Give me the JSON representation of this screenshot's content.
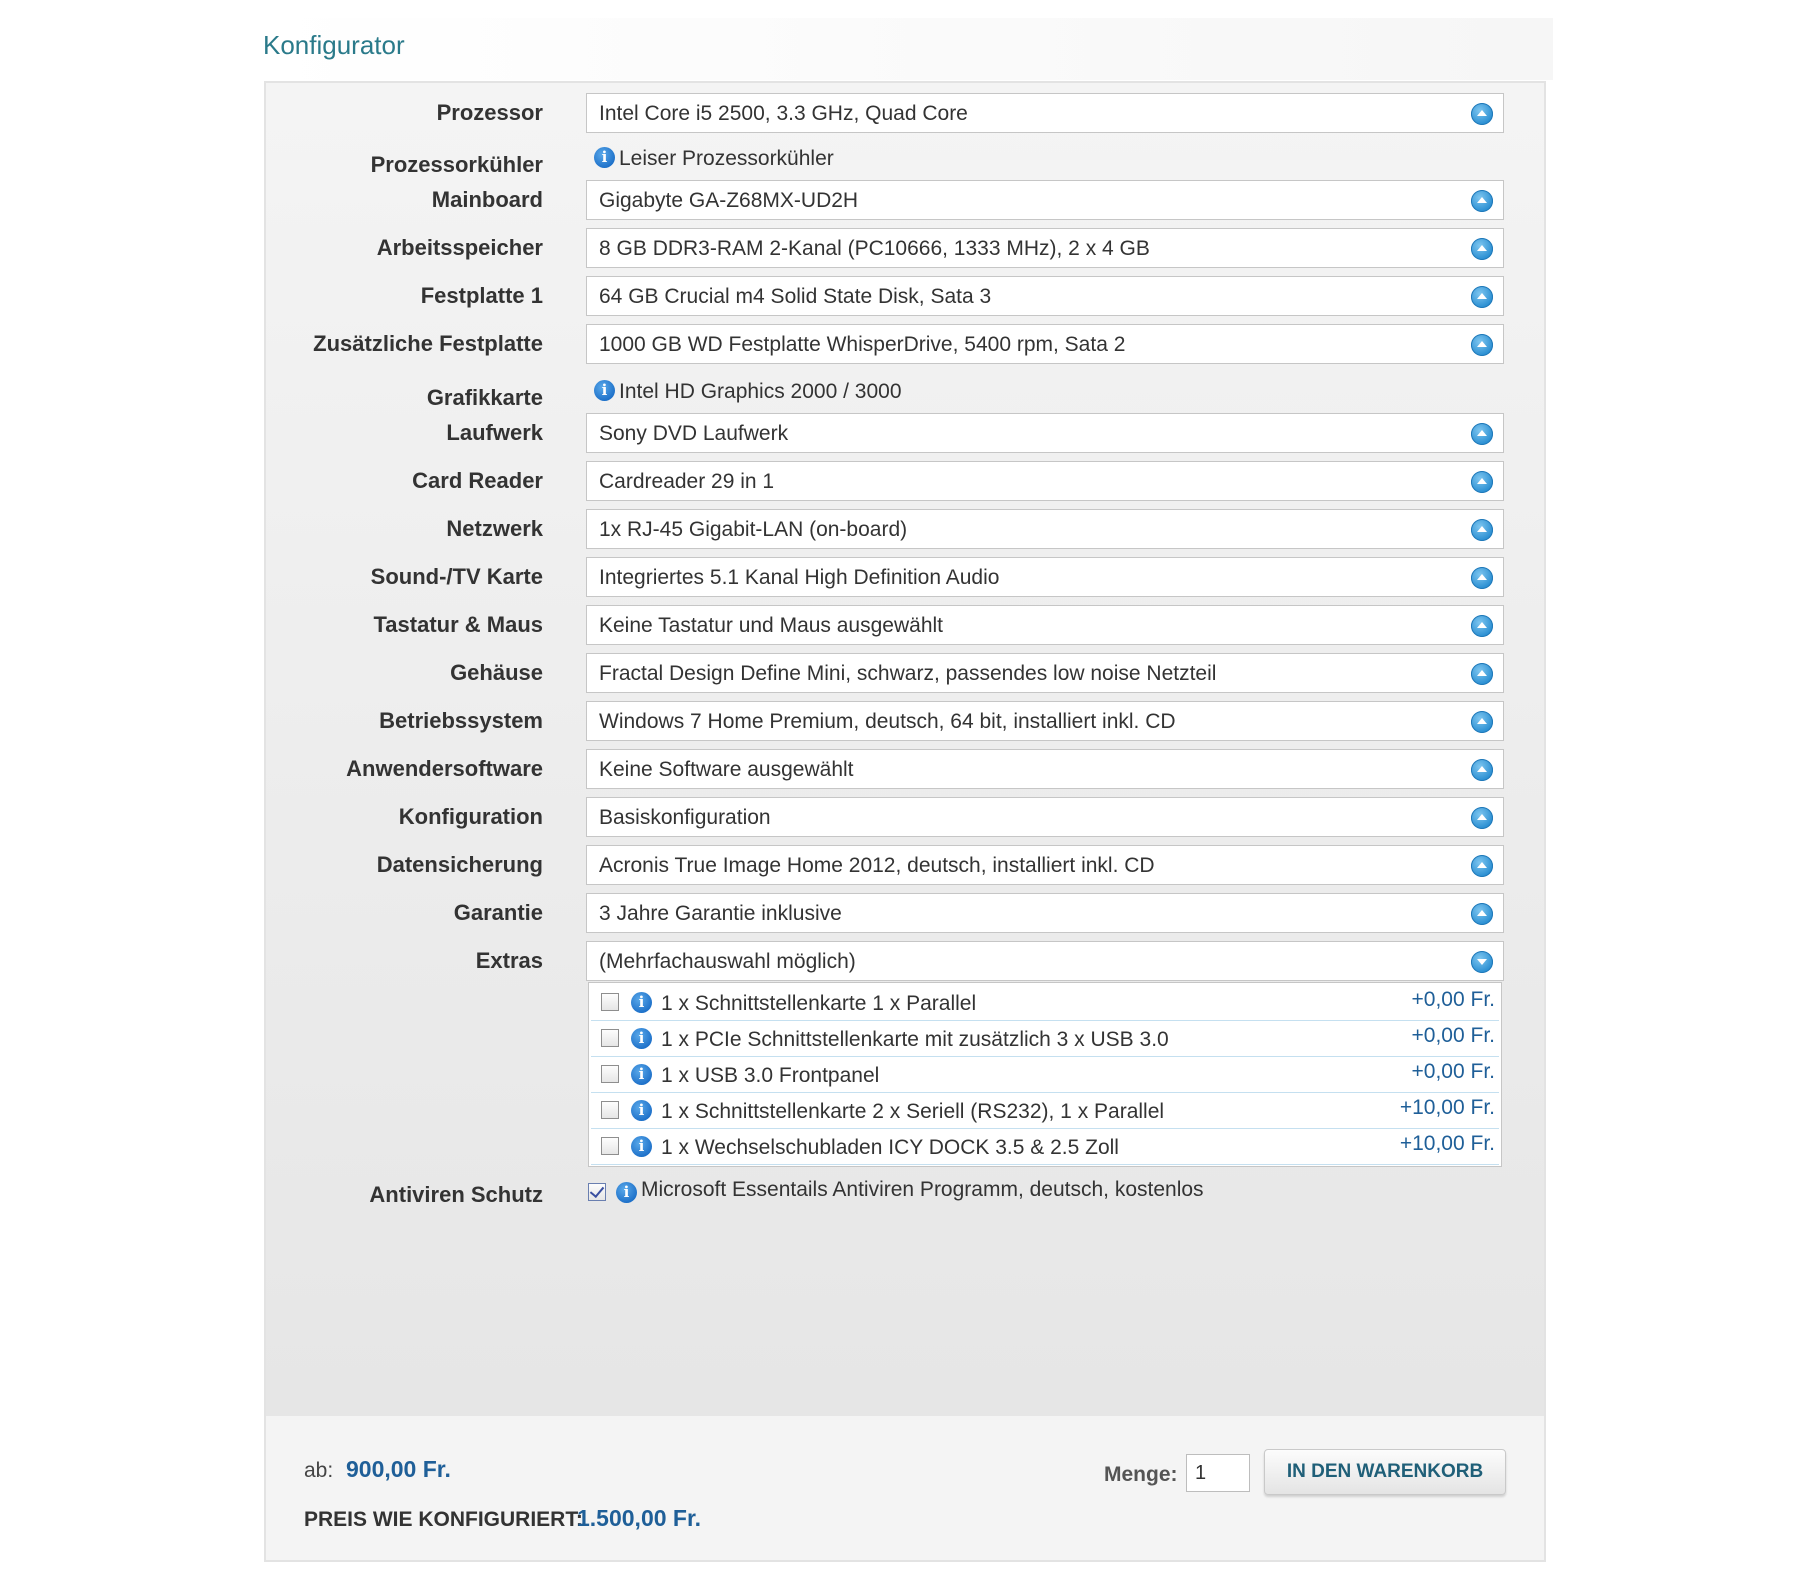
{
  "page": {
    "title": "Konfigurator"
  },
  "configurator": {
    "rows": [
      {
        "label": "Prozessor",
        "value": "Intel Core i5 2500, 3.3 GHz, Quad Core"
      },
      {
        "label": "Prozessorkühler",
        "value": "Leiser Prozessorkühler"
      },
      {
        "label": "Mainboard",
        "value": "Gigabyte GA-Z68MX-UD2H"
      },
      {
        "label": "Arbeitsspeicher",
        "value": "8 GB DDR3-RAM 2-Kanal (PC10666, 1333 MHz), 2 x 4 GB"
      },
      {
        "label": "Festplatte 1",
        "value": "64 GB Crucial m4 Solid State Disk, Sata 3"
      },
      {
        "label": "Zusätzliche Festplatte",
        "value": "1000 GB WD Festplatte WhisperDrive, 5400 rpm, Sata 2"
      },
      {
        "label": "Grafikkarte",
        "value": "Intel HD Graphics 2000 / 3000"
      },
      {
        "label": "Laufwerk",
        "value": "Sony DVD Laufwerk"
      },
      {
        "label": "Card Reader",
        "value": "Cardreader 29 in 1"
      },
      {
        "label": "Netzwerk",
        "value": "1x RJ-45 Gigabit-LAN (on-board)"
      },
      {
        "label": "Sound-/TV Karte",
        "value": "Integriertes 5.1 Kanal High Definition Audio"
      },
      {
        "label": "Tastatur & Maus",
        "value": "Keine Tastatur und Maus ausgewählt"
      },
      {
        "label": "Gehäuse",
        "value": "Fractal Design Define Mini, schwarz, passendes low noise Netzteil"
      },
      {
        "label": "Betriebssystem",
        "value": "Windows 7 Home Premium, deutsch, 64 bit, installiert inkl. CD"
      },
      {
        "label": "Anwendersoftware",
        "value": "Keine Software ausgewählt"
      },
      {
        "label": "Konfiguration",
        "value": "Basiskonfiguration"
      },
      {
        "label": "Datensicherung",
        "value": "Acronis True Image Home 2012, deutsch, installiert inkl. CD"
      },
      {
        "label": "Garantie",
        "value": "3 Jahre Garantie inklusive"
      },
      {
        "label": "Extras",
        "value": "(Mehrfachauswahl möglich)"
      }
    ],
    "extras": [
      {
        "label": "1 x Schnittstellenkarte 1 x Parallel",
        "price": "+0,00 Fr.",
        "checked": false
      },
      {
        "label": "1 x PCIe Schnittstellenkarte mit zusätzlich 3 x USB 3.0",
        "price": "+0,00 Fr.",
        "checked": false
      },
      {
        "label": "1 x USB 3.0 Frontpanel",
        "price": "+0,00 Fr.",
        "checked": false
      },
      {
        "label": "1 x Schnittstellenkarte 2 x Seriell (RS232), 1 x Parallel",
        "price": "+10,00 Fr.",
        "checked": false
      },
      {
        "label": "1 x Wechselschubladen ICY DOCK 3.5 & 2.5 Zoll",
        "price": "+10,00 Fr.",
        "checked": false
      }
    ],
    "antivirus": {
      "label": "Antiviren Schutz",
      "value": "Microsoft Essentails Antiviren Programm, deutsch, kostenlos",
      "checked": true
    }
  },
  "footer": {
    "price_from_label": "ab:",
    "price_from_value": "900,00 Fr.",
    "price_configured_label": "PREIS WIE KONFIGURIERT:",
    "price_configured_value": "1.500,00 Fr.",
    "quantity_label": "Menge:",
    "quantity_value": "1",
    "cart_button_label": "IN DEN WARENKORB"
  },
  "colors": {
    "title": "#2a7a8a",
    "price": "#1f5f98",
    "accent_blue": "#2b8fd2"
  },
  "icons": {
    "select_arrow": "chevron-circle-icon",
    "info": "info-icon"
  }
}
